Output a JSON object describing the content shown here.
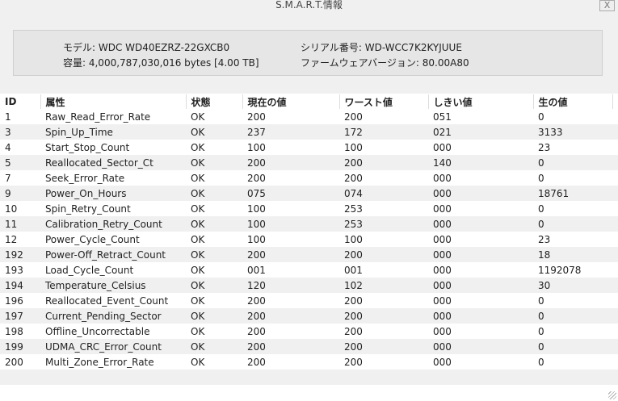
{
  "window": {
    "title": "S.M.A.R.T.情報",
    "close_label": "X"
  },
  "info": {
    "model": "モデル: WDC WD40EZRZ-22GXCB0",
    "capacity": "容量: 4,000,787,030,016 bytes [4.00 TB]",
    "serial": "シリアル番号: WD-WCC7K2KYJUUE",
    "firmware": "ファームウェアバージョン: 80.00A80"
  },
  "table": {
    "headers": [
      "ID",
      "属性",
      "状態",
      "現在の値",
      "ワースト値",
      "しきい値",
      "生の値"
    ],
    "rows": [
      [
        "1",
        "Raw_Read_Error_Rate",
        "OK",
        "200",
        "200",
        "051",
        "0"
      ],
      [
        "3",
        "Spin_Up_Time",
        "OK",
        "237",
        "172",
        "021",
        "3133"
      ],
      [
        "4",
        "Start_Stop_Count",
        "OK",
        "100",
        "100",
        "000",
        "23"
      ],
      [
        "5",
        "Reallocated_Sector_Ct",
        "OK",
        "200",
        "200",
        "140",
        "0"
      ],
      [
        "7",
        "Seek_Error_Rate",
        "OK",
        "200",
        "200",
        "000",
        "0"
      ],
      [
        "9",
        "Power_On_Hours",
        "OK",
        "075",
        "074",
        "000",
        "18761"
      ],
      [
        "10",
        "Spin_Retry_Count",
        "OK",
        "100",
        "253",
        "000",
        "0"
      ],
      [
        "11",
        "Calibration_Retry_Count",
        "OK",
        "100",
        "253",
        "000",
        "0"
      ],
      [
        "12",
        "Power_Cycle_Count",
        "OK",
        "100",
        "100",
        "000",
        "23"
      ],
      [
        "192",
        "Power-Off_Retract_Count",
        "OK",
        "200",
        "200",
        "000",
        "18"
      ],
      [
        "193",
        "Load_Cycle_Count",
        "OK",
        "001",
        "001",
        "000",
        "1192078"
      ],
      [
        "194",
        "Temperature_Celsius",
        "OK",
        "120",
        "102",
        "000",
        "30"
      ],
      [
        "196",
        "Reallocated_Event_Count",
        "OK",
        "200",
        "200",
        "000",
        "0"
      ],
      [
        "197",
        "Current_Pending_Sector",
        "OK",
        "200",
        "200",
        "000",
        "0"
      ],
      [
        "198",
        "Offline_Uncorrectable",
        "OK",
        "200",
        "200",
        "000",
        "0"
      ],
      [
        "199",
        "UDMA_CRC_Error_Count",
        "OK",
        "200",
        "200",
        "000",
        "0"
      ],
      [
        "200",
        "Multi_Zone_Error_Rate",
        "OK",
        "200",
        "200",
        "000",
        "0"
      ]
    ]
  }
}
